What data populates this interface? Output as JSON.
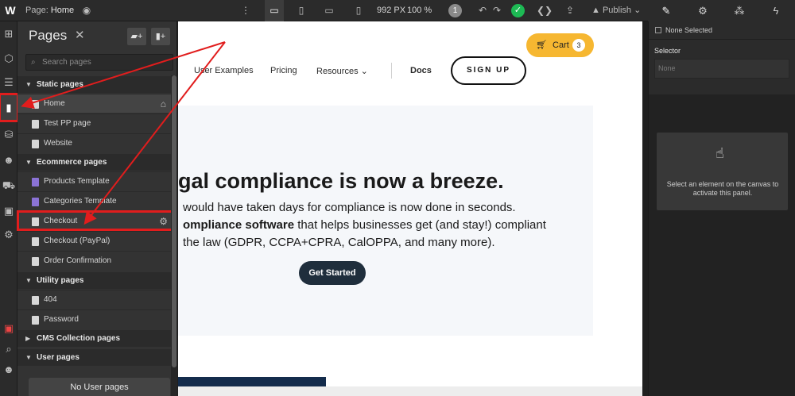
{
  "topbar": {
    "logo": "W",
    "page_prefix": "Page:",
    "page_name": "Home",
    "width_px": "992 PX",
    "zoom": "100 %",
    "badge_count": "1",
    "publish_label": "Publish"
  },
  "pages_panel": {
    "title": "Pages",
    "search_placeholder": "Search pages",
    "sections": {
      "static": "Static pages",
      "ecommerce": "Ecommerce pages",
      "utility": "Utility pages",
      "cms": "CMS Collection pages",
      "user": "User pages"
    },
    "static_pages": [
      "Home",
      "Test PP page",
      "Website"
    ],
    "ecommerce_pages": [
      "Products Template",
      "Categories Template",
      "Checkout",
      "Checkout (PayPal)",
      "Order Confirmation"
    ],
    "utility_pages": [
      "404",
      "Password"
    ],
    "no_user_pages": "No User pages"
  },
  "site": {
    "nav": {
      "examples": "User Examples",
      "pricing": "Pricing",
      "resources": "Resources",
      "docs": "Docs",
      "signup": "SIGN UP"
    },
    "cart": {
      "label": "Cart",
      "count": "3"
    },
    "hero": {
      "title": "gal compliance is now a breeze.",
      "line1": "would have taken days for compliance is now done in seconds.",
      "line2_bold": "ompliance software",
      "line2_rest": " that helps businesses get (and stay!) compliant",
      "line3": "the law (GDPR, CCPA+CPRA, CalOPPA, and many more).",
      "cta": "Get Started"
    }
  },
  "right_panel": {
    "none_selected": "None Selected",
    "selector_label": "Selector",
    "selector_placeholder": "None",
    "info_text": "Select an element on the canvas to activate this panel."
  },
  "colors": {
    "annotation_red": "#e11d1d",
    "cart_yellow": "#f6b731",
    "cta_navy": "#1f2e3c",
    "check_green": "#1db954",
    "ecom_page_purple": "#8b73d6"
  }
}
